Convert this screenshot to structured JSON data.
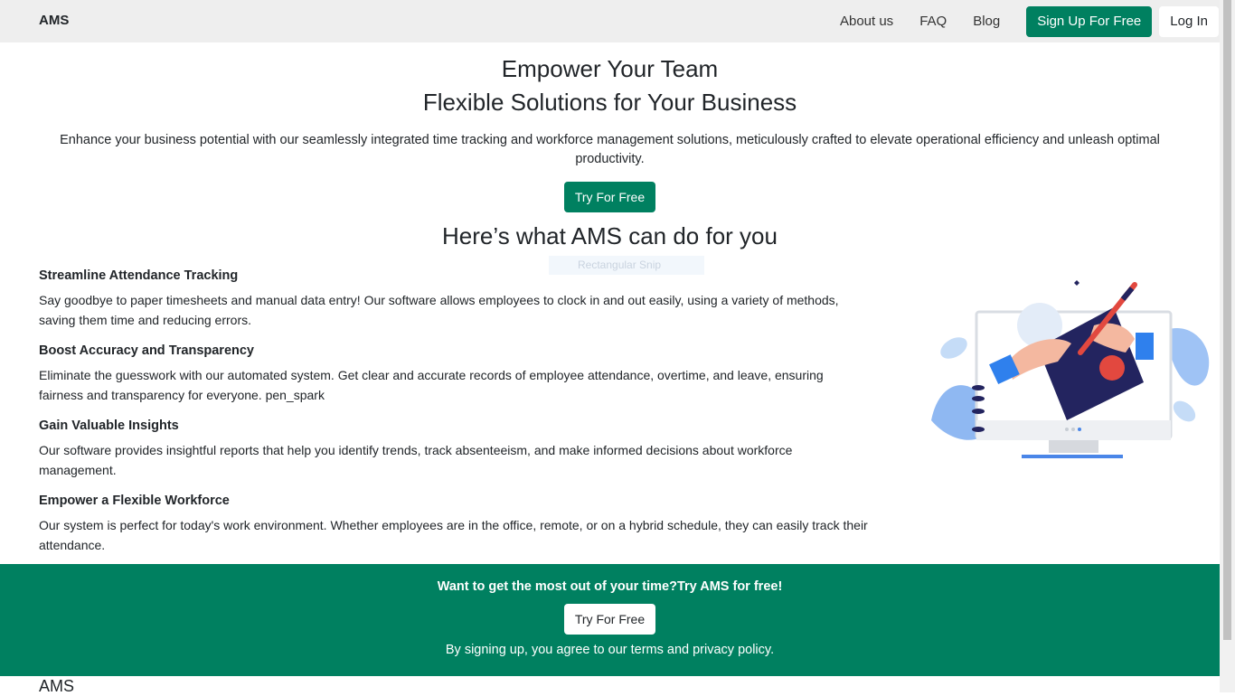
{
  "nav": {
    "brand": "AMS",
    "links": [
      "About us",
      "FAQ",
      "Blog"
    ],
    "signup": "Sign Up For Free",
    "login": "Log In"
  },
  "hero": {
    "title1": "Empower Your Team",
    "title2": "Flexible Solutions for Your Business",
    "description": "Enhance your business potential with our seamlessly integrated time tracking and workforce management solutions, meticulously crafted to elevate operational efficiency and unleash optimal productivity.",
    "cta": "Try For Free"
  },
  "section": {
    "title": "Here’s what AMS can do for you",
    "snip_label": "Rectangular Snip"
  },
  "features": [
    {
      "title": "Streamline Attendance Tracking",
      "text": "Say goodbye to paper timesheets and manual data entry! Our software allows employees to clock in and out easily, using a variety of methods, saving them time and reducing errors."
    },
    {
      "title": "Boost Accuracy and Transparency",
      "text": "Eliminate the guesswork with our automated system. Get clear and accurate records of employee attendance, overtime, and leave, ensuring fairness and transparency for everyone. pen_spark"
    },
    {
      "title": "Gain Valuable Insights",
      "text": "Our software provides insightful reports that help you identify trends, track absenteeism, and make informed decisions about workforce management."
    },
    {
      "title": "Empower a Flexible Workforce",
      "text": "Our system is perfect for today's work environment. Whether employees are in the office, remote, or on a hybrid schedule, they can easily track their attendance."
    }
  ],
  "cta_banner": {
    "title": "Want to get the most out of your time?Try AMS for free!",
    "button": "Try For Free",
    "note": "By signing up, you agree to our terms and privacy policy."
  },
  "footer": {
    "brand": "AMS"
  },
  "colors": {
    "primary": "#008060",
    "navbar_bg": "#eeeeee"
  }
}
